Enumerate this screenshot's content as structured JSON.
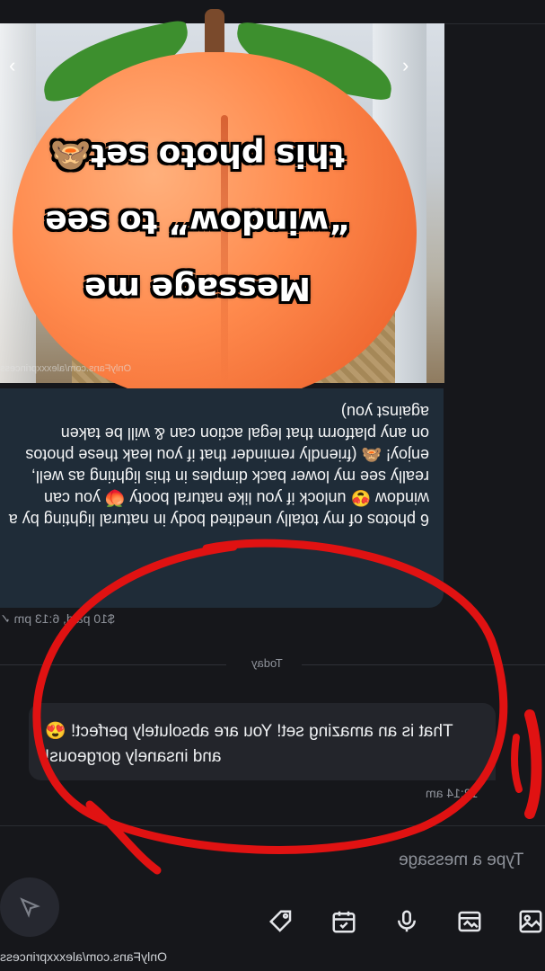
{
  "post": {
    "overlay_lines": [
      "Message me",
      "“window” to see",
      "this photo set🙈"
    ],
    "image_watermark": "OnlyFans.com/alexxxprincess",
    "caption": "6 photos of my totally unedited body in natural lighting by a window 😍 unlock if you like natural booty 🍑 you can really see my lower back dimples in this lighting as well, enjoy! 🙈 (friendly reminder that if you leak these photos on any platform that legal action can & will be taken against you)",
    "meta": "$10 paid, 6:13 pm ✓"
  },
  "divider": {
    "label": "Today"
  },
  "reply": {
    "text": "That is an amazing set! You are absolutely perfect! 😍 and insanely gorgeous!",
    "time": "12:14 am"
  },
  "composer": {
    "placeholder": "Type a message",
    "icons": [
      "send-icon",
      "tag-icon",
      "calendar-icon",
      "microphone-icon",
      "vault-icon",
      "image-icon"
    ]
  },
  "footer_watermark": "OnlyFans.com/alexxxprincess",
  "colors": {
    "background": "#16171b",
    "incoming_bubble": "#1f2c38",
    "outgoing_bubble": "#23252b",
    "annotation": "#e01212"
  }
}
